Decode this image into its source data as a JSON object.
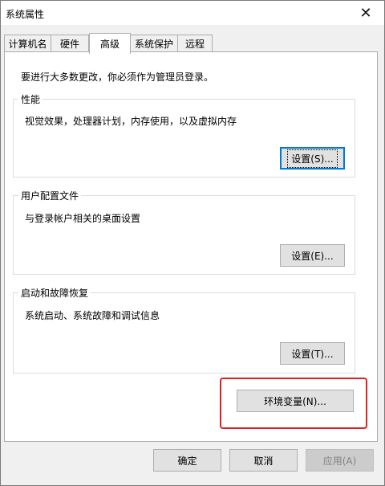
{
  "window": {
    "title": "系统属性",
    "close_glyph": "✕"
  },
  "tabs": [
    {
      "label": "计算机名",
      "active": false
    },
    {
      "label": "硬件",
      "active": false
    },
    {
      "label": "高级",
      "active": true
    },
    {
      "label": "系统保护",
      "active": false
    },
    {
      "label": "远程",
      "active": false
    }
  ],
  "panel": {
    "admin_note": "要进行大多数更改，你必须作为管理员登录。",
    "performance": {
      "title": "性能",
      "description": "视觉效果，处理器计划，内存使用，以及虚拟内存",
      "button": "设置(S)..."
    },
    "user_profiles": {
      "title": "用户配置文件",
      "description": "与登录帐户相关的桌面设置",
      "button": "设置(E)..."
    },
    "startup_recovery": {
      "title": "启动和故障恢复",
      "description": "系统启动、系统故障和调试信息",
      "button": "设置(T)..."
    },
    "env_vars_button": "环境变量(N)..."
  },
  "footer": {
    "ok": "确定",
    "cancel": "取消",
    "apply": "应用(A)"
  },
  "colors": {
    "highlight": "#e02020",
    "focus": "#0078d7"
  }
}
